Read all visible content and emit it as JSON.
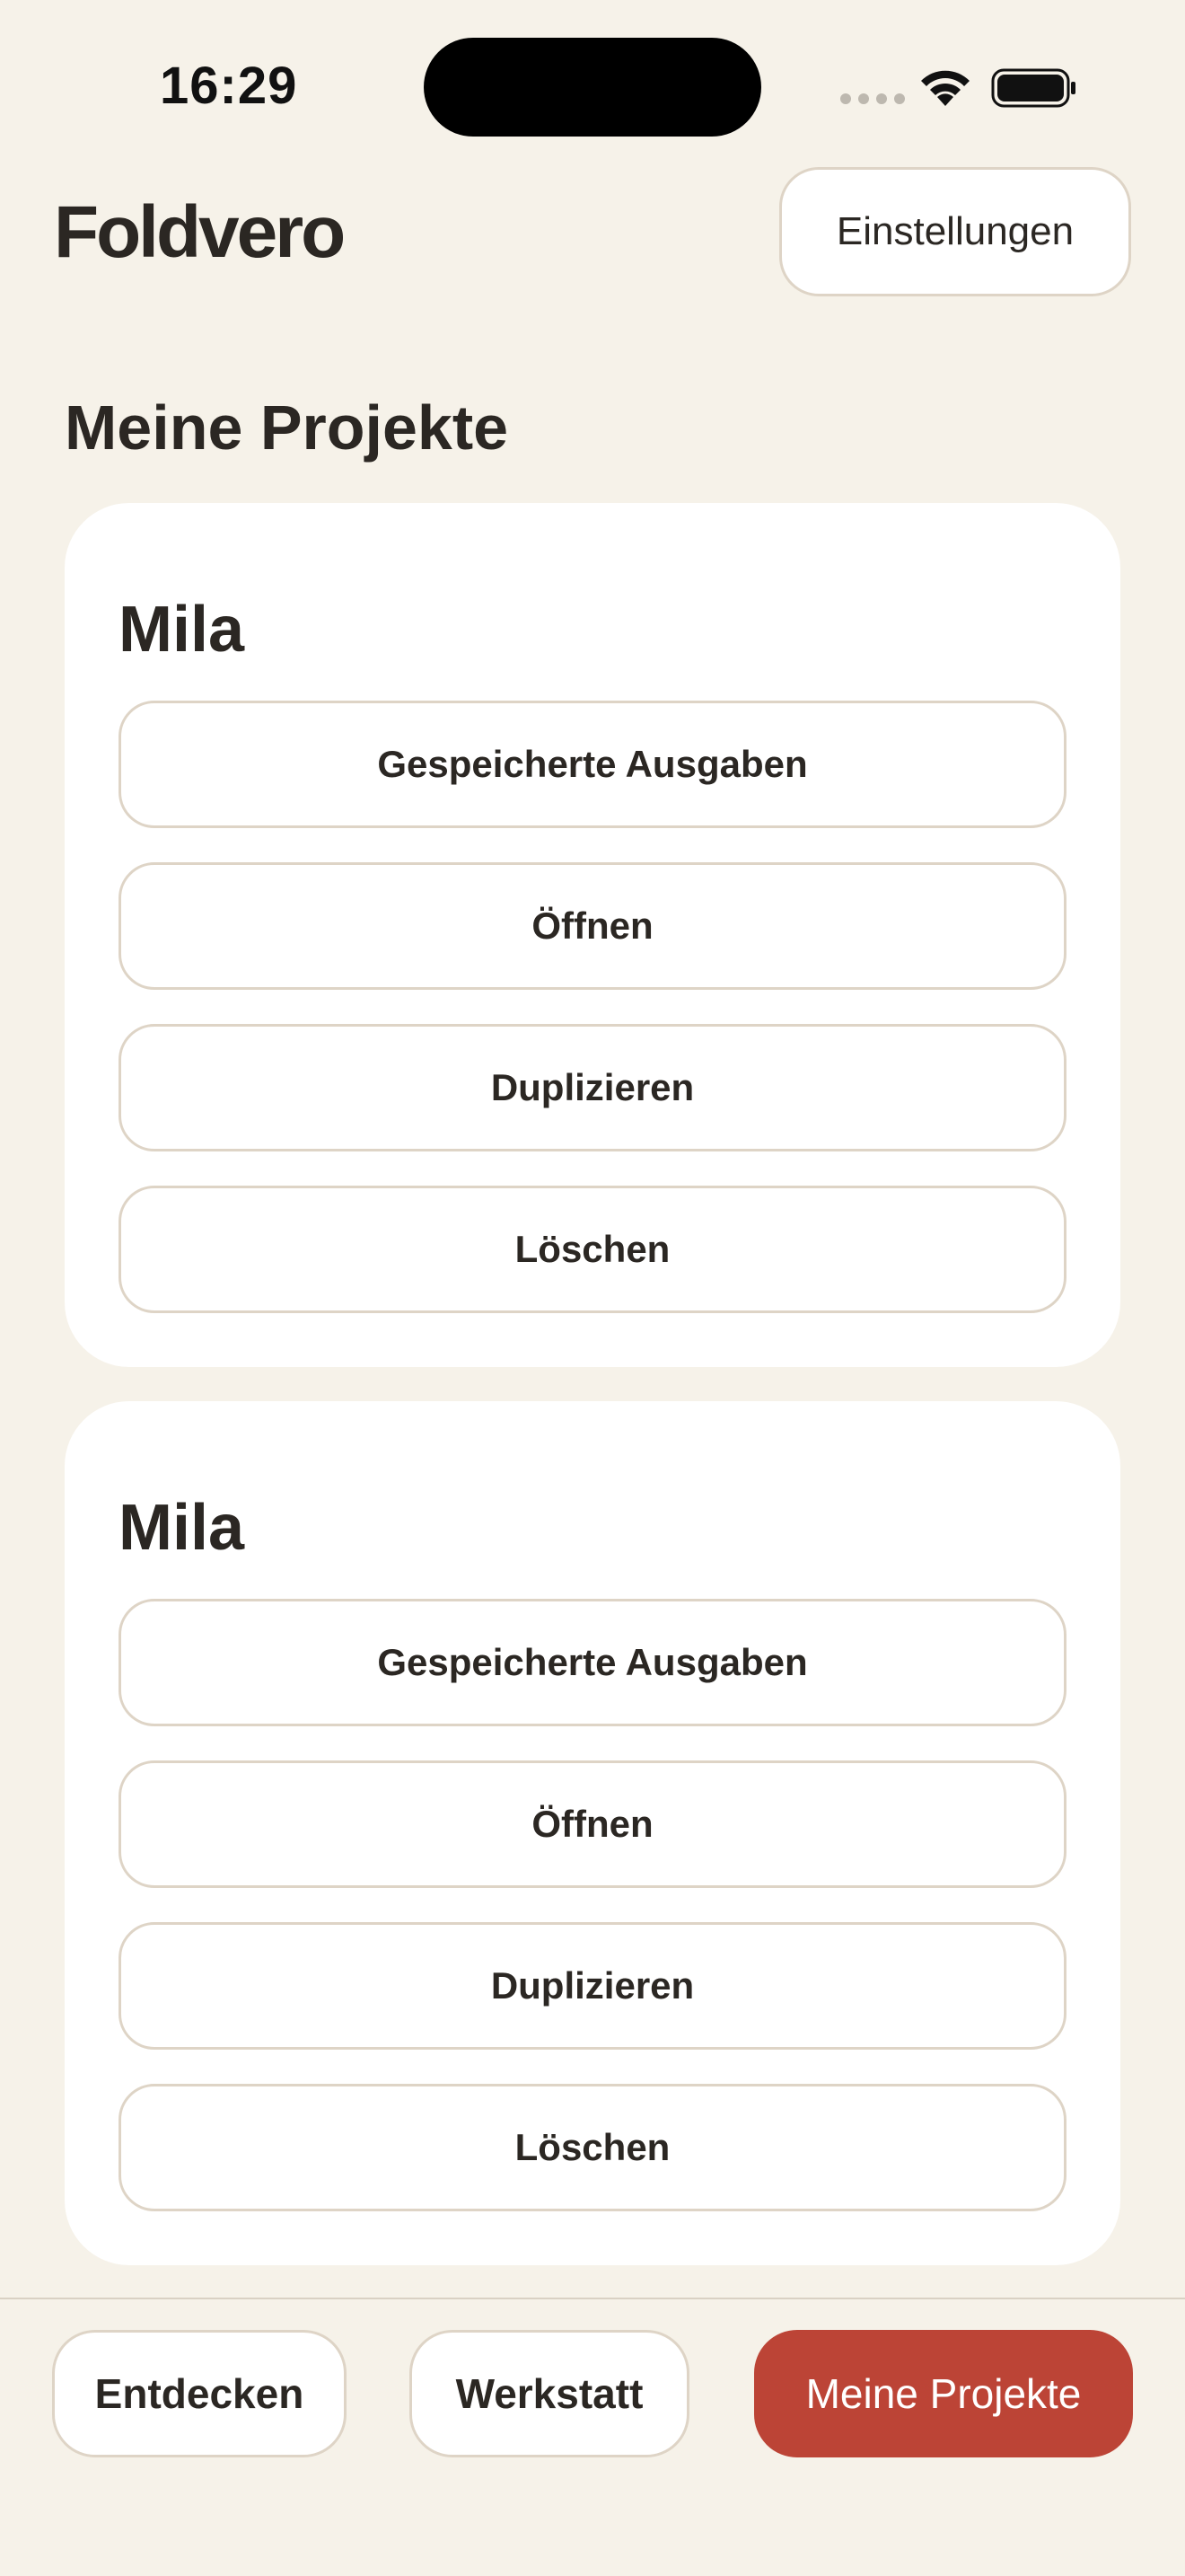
{
  "status_bar": {
    "time": "16:29",
    "icons": [
      "signal-icon",
      "wifi-icon",
      "battery-icon"
    ]
  },
  "header": {
    "logo": "Foldvero",
    "settings_label": "Einstellungen"
  },
  "section": {
    "title": "Meine Projekte"
  },
  "projects": [
    {
      "name": "Mila",
      "actions": [
        "Gespeicherte Ausgaben",
        "Öffnen",
        "Duplizieren",
        "Löschen"
      ]
    },
    {
      "name": "Mila",
      "actions": [
        "Gespeicherte Ausgaben",
        "Öffnen",
        "Duplizieren",
        "Löschen"
      ]
    }
  ],
  "bottom_nav": {
    "items": [
      {
        "label": "Entdecken",
        "active": false
      },
      {
        "label": "Werkstatt",
        "active": false
      },
      {
        "label": "Meine Projekte",
        "active": true
      }
    ]
  },
  "colors": {
    "background": "#F6F2E9",
    "card": "#FFFFFF",
    "border": "#DED4C6",
    "text": "#2B2723",
    "accent": "#BC4436"
  }
}
